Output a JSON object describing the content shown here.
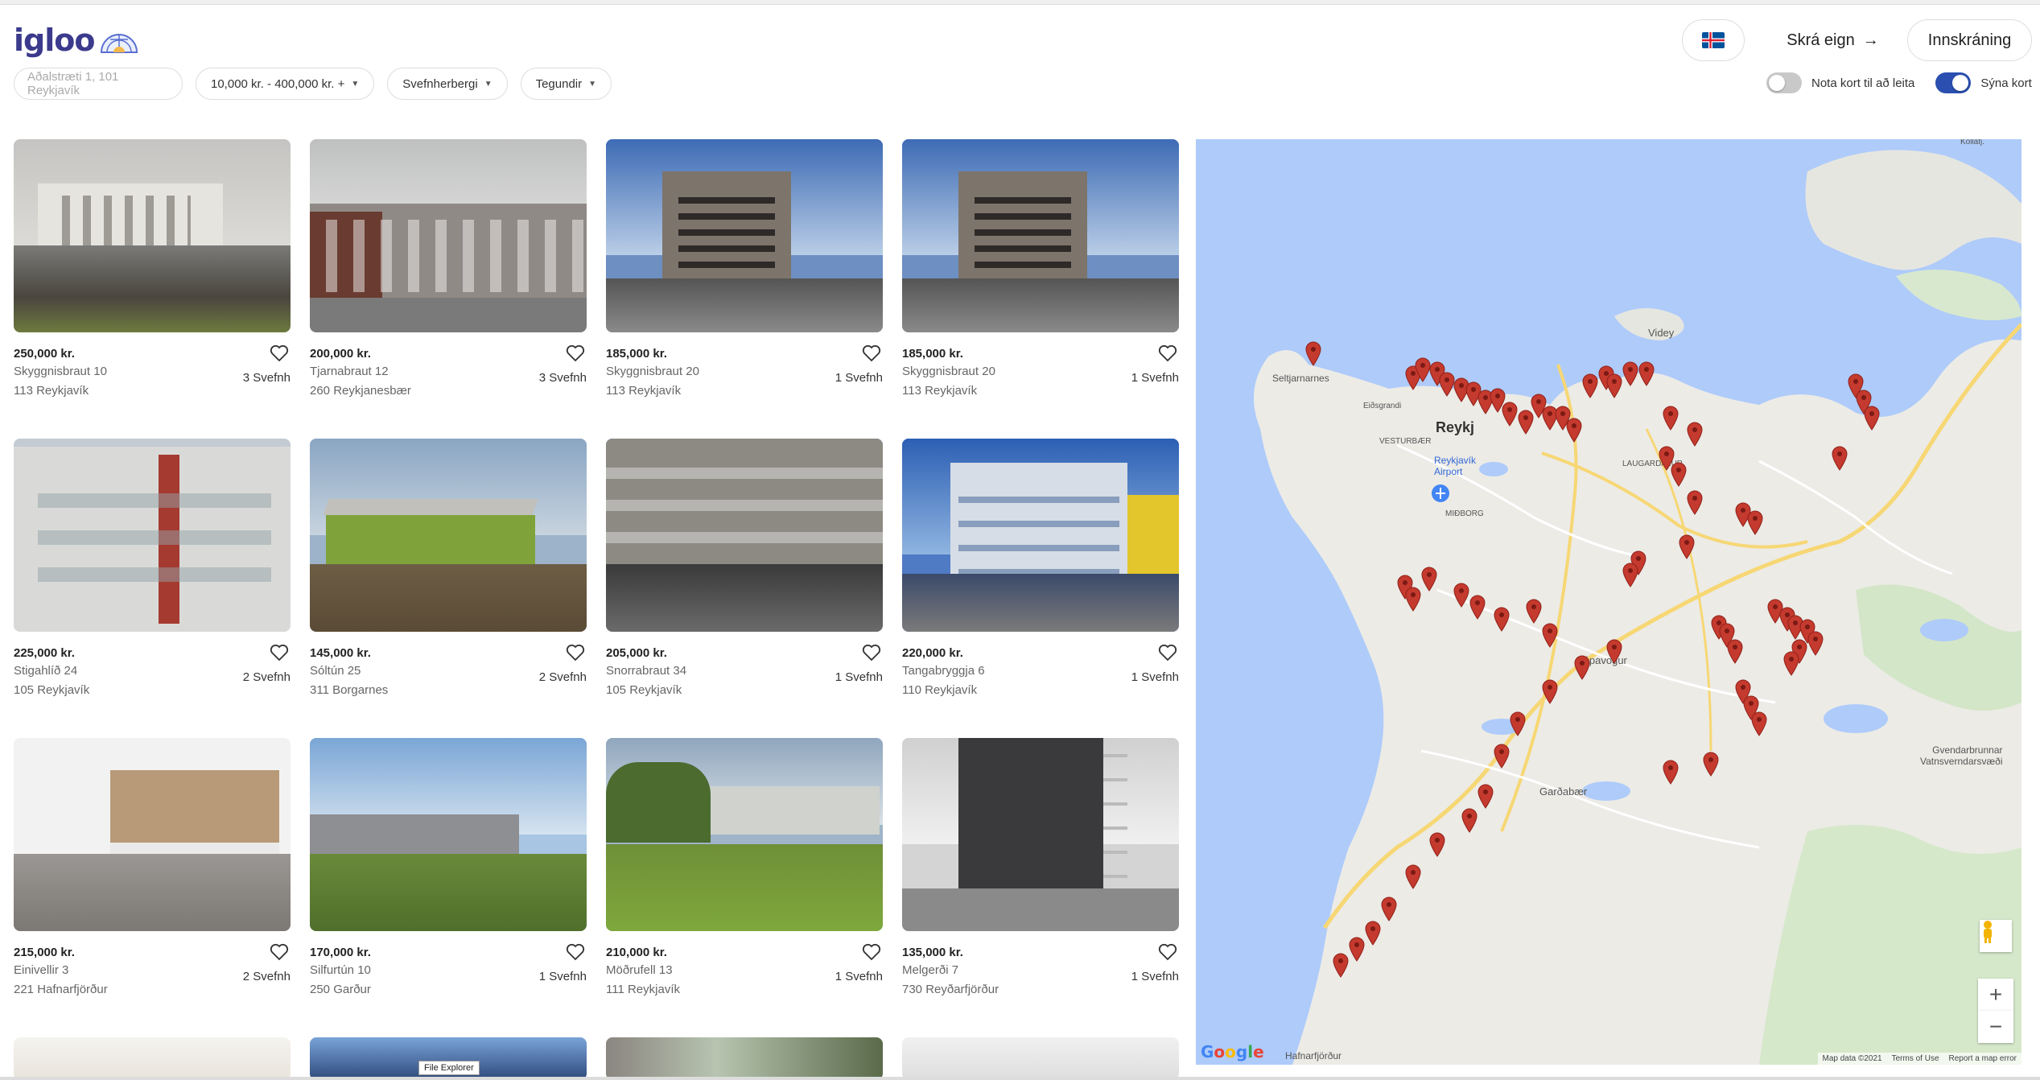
{
  "header": {
    "logo_text": "igloo",
    "list_property": "Skrá eign",
    "login": "Innskráning",
    "language_flag": "iceland-flag-icon"
  },
  "filters": {
    "search_placeholder": "Aðalstræti 1, 101 Reykjavík",
    "price": "10,000 kr. - 400,000 kr. +",
    "bedrooms": "Svefnherbergi",
    "types": "Tegundir"
  },
  "toggles": {
    "map_search": "Nota kort til að leita",
    "map_search_on": false,
    "show_map": "Sýna kort",
    "show_map_on": true
  },
  "listings": [
    {
      "price": "250,000 kr.",
      "street": "Skyggnisbraut 10",
      "city": "113 Reykjavík",
      "rooms": "3 Svefnh"
    },
    {
      "price": "200,000 kr.",
      "street": "Tjarnabraut 12",
      "city": "260 Reykjanesbær",
      "rooms": "3 Svefnh"
    },
    {
      "price": "185,000 kr.",
      "street": "Skyggnisbraut 20",
      "city": "113 Reykjavík",
      "rooms": "1 Svefnh"
    },
    {
      "price": "185,000 kr.",
      "street": "Skyggnisbraut 20",
      "city": "113 Reykjavík",
      "rooms": "1 Svefnh"
    },
    {
      "price": "225,000 kr.",
      "street": "Stigahlíð 24",
      "city": "105 Reykjavík",
      "rooms": "2 Svefnh"
    },
    {
      "price": "145,000 kr.",
      "street": "Sóltún 25",
      "city": "311 Borgarnes",
      "rooms": "2 Svefnh"
    },
    {
      "price": "205,000 kr.",
      "street": "Snorrabraut 34",
      "city": "105 Reykjavík",
      "rooms": "1 Svefnh"
    },
    {
      "price": "220,000 kr.",
      "street": "Tangabryggja 6",
      "city": "110 Reykjavík",
      "rooms": "1 Svefnh"
    },
    {
      "price": "215,000 kr.",
      "street": "Einivellir 3",
      "city": "221 Hafnarfjörður",
      "rooms": "2 Svefnh"
    },
    {
      "price": "170,000 kr.",
      "street": "Silfurtún 10",
      "city": "250 Garður",
      "rooms": "1 Svefnh"
    },
    {
      "price": "210,000 kr.",
      "street": "Möðrufell 13",
      "city": "111 Reykjavík",
      "rooms": "1 Svefnh"
    },
    {
      "price": "135,000 kr.",
      "street": "Melgerði 7",
      "city": "730 Reyðarfjörður",
      "rooms": "1 Svefnh"
    }
  ],
  "map": {
    "labels": {
      "seltjarnarnes": "Seltjarnarnes",
      "videy": "Videy",
      "reykjavik": "Reykj",
      "airport": "Reykjavík\nAirport",
      "vesturbaer": "VESTURBÆR",
      "midborg": "MIÐBORG",
      "laugardalur": "LAUGARDALUR",
      "kopavogur": "Kópavogur",
      "gardabaer": "Garðabær",
      "hafnarfjordur": "Hafnarfjörður",
      "gvendarbrunnar": "Gvendarbrunnar\nVatnsverndarsvæði",
      "eidsgrandi": "Eiðsgrandi",
      "kollafjordur": "Kollafj."
    },
    "google": "Google",
    "map_data": "Map data ©2021",
    "terms": "Terms of Use",
    "report": "Report a map error",
    "zoom_in": "+",
    "zoom_out": "−"
  },
  "taskbar_tooltip": "File Explorer"
}
